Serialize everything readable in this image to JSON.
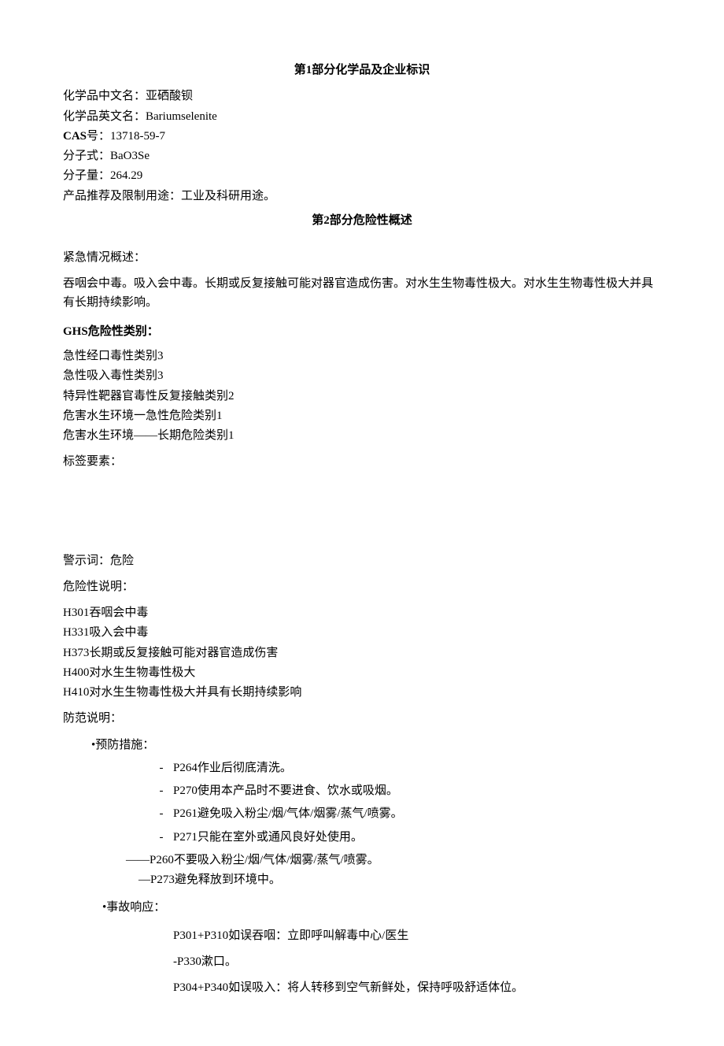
{
  "section1": {
    "title_prefix": "第",
    "title_num": "1",
    "title_suffix": "部分化学品及企业标识",
    "name_cn_label": "化学品中文名：",
    "name_cn": "亚硒酸钡",
    "name_en_label": "化学品英文名：",
    "name_en": "Bariumselenite",
    "cas_label": "CAS",
    "cas_sep": "号：",
    "cas": "13718-59-7",
    "formula_label": "分子式：",
    "formula": "BaO3Se",
    "mw_label": "分子量：",
    "mw": "264.29",
    "usage_label": "产品推荐及限制用途：",
    "usage": "工业及科研用途。"
  },
  "section2": {
    "title_prefix": "第",
    "title_num": "2",
    "title_suffix": "部分危险性概述",
    "emergency_heading": "紧急情况概述：",
    "emergency_text": "吞咽会中毒。吸入会中毒。长期或反复接触可能对器官造成伤害。对水生生物毒性极大。对水生生物毒性极大并具有长期持续影响。",
    "ghs_heading_prefix": "GHS",
    "ghs_heading_suffix": "危险性类别：",
    "ghs_classes": [
      "急性经口毒性类别3",
      "急性吸入毒性类别3",
      "特异性靶器官毒性反复接触类别2",
      "危害水生环境一急性危险类别1",
      "危害水生环境——长期危险类别1"
    ],
    "label_elements": "标签要素：",
    "signal_word_label": "警示词：",
    "signal_word": "危险",
    "hazard_heading": "危险性说明：",
    "hazard_statements": [
      "H301吞咽会中毒",
      "H331吸入会中毒",
      "H373长期或反复接触可能对器官造成伤害",
      "H400对水生生物毒性极大",
      "H410对水生生物毒性极大并具有长期持续影响"
    ],
    "precaution_heading": "防范说明：",
    "prevention_label": "•预防措施：",
    "prevention_items": [
      "P264作业后彻底清洗。",
      "P270使用本产品时不要进食、饮水或吸烟。",
      "P261避免吸入粉尘/烟/气体/烟雾/蒸气/喷雾。",
      "P271只能在室外或通风良好处使用。"
    ],
    "prevention_tail1": "——P260不要吸入粉尘/烟/气体/烟雾/蒸气/喷雾。",
    "prevention_tail2": "—P273避免释放到环境中。",
    "response_label": "•事故响应：",
    "response_items": [
      "P301+P310如误吞咽：立即呼叫解毒中心/医生",
      "-P330漱口。",
      "P304+P340如误吸入：将人转移到空气新鲜处，保持呼吸舒适体位。"
    ]
  }
}
